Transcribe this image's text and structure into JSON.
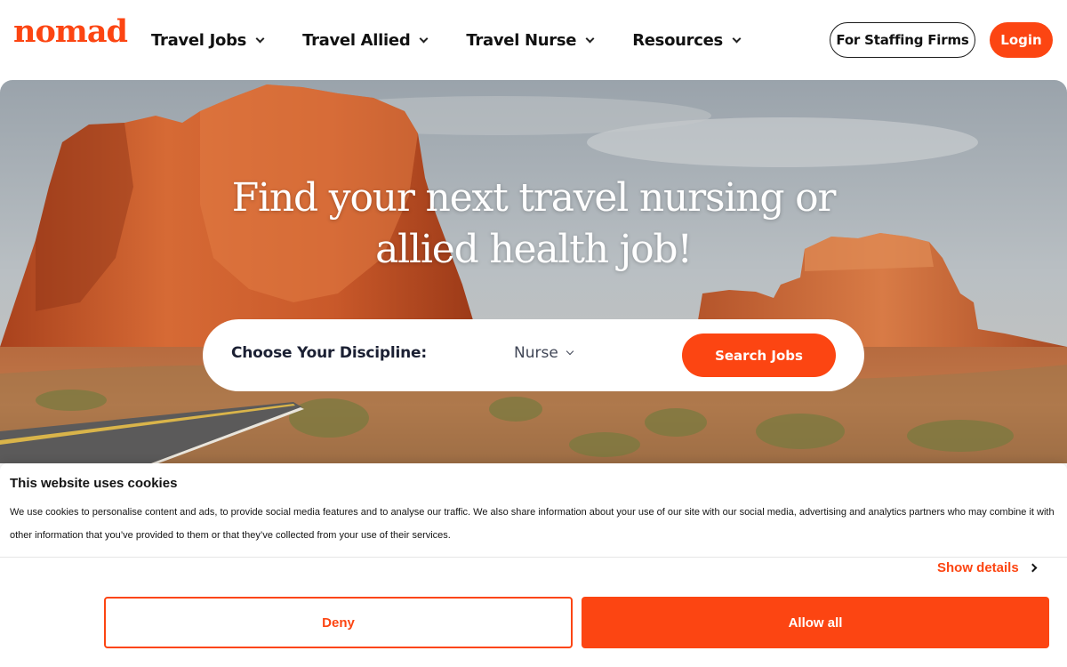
{
  "brand": {
    "logo_text": "nomad",
    "accent_color": "#fc4512"
  },
  "nav": {
    "items": [
      {
        "label": "Travel Jobs",
        "icon": "chevron-down-icon"
      },
      {
        "label": "Travel Allied",
        "icon": "chevron-down-icon"
      },
      {
        "label": "Travel Nurse",
        "icon": "chevron-down-icon"
      },
      {
        "label": "Resources",
        "icon": "chevron-down-icon"
      }
    ],
    "staffing_button": "For Staffing Firms",
    "login_button": "Login"
  },
  "hero": {
    "title": "Find your next travel nursing or allied health job!",
    "background": "desert-red-rock-landscape"
  },
  "search": {
    "discipline_label": "Choose Your Discipline:",
    "discipline_value": "Nurse",
    "submit_label": "Search Jobs"
  },
  "cookie_banner": {
    "title": "This website uses cookies",
    "text": "We use cookies to personalise content and ads, to provide social media features and to analyse our traffic. We also share information about your use of our site with our social media, advertising and analytics partners who may combine it with other information that you’ve provided to them or that they’ve collected from your use of their services.",
    "show_details": "Show details",
    "deny_label": "Deny",
    "allow_label": "Allow all"
  }
}
